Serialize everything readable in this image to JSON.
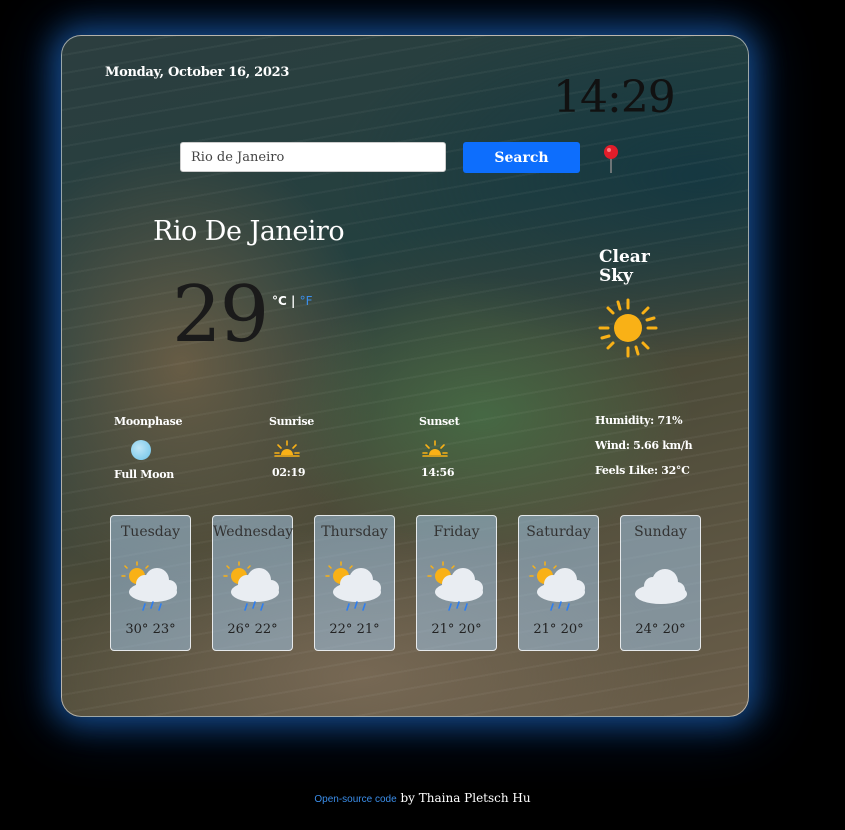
{
  "header": {
    "date": "Monday, October 16, 2023",
    "time": "14:29"
  },
  "search": {
    "value": "Rio de Janeiro",
    "placeholder": "",
    "button_label": "Search",
    "location_icon": "map-pin-icon"
  },
  "current": {
    "city": "Rio De Janeiro",
    "temperature": "29",
    "unit_c": "°C",
    "unit_separator": " | ",
    "unit_f": "°F",
    "description": "Clear Sky",
    "icon": "sun-icon"
  },
  "details": {
    "moonphase_label": "Moonphase",
    "moonphase_value": "Full Moon",
    "sunrise_label": "Sunrise",
    "sunrise_value": "02:19",
    "sunset_label": "Sunset",
    "sunset_value": "14:56",
    "humidity": "Humidity: 71%",
    "wind": "Wind: 5.66 km/h",
    "feels_like": "Feels Like: 32°C"
  },
  "forecast": [
    {
      "day": "Tuesday",
      "temps": "30° 23°",
      "icon": "sun-cloud-rain-icon"
    },
    {
      "day": "Wednesday",
      "temps": "26° 22°",
      "icon": "sun-cloud-rain-icon"
    },
    {
      "day": "Thursday",
      "temps": "22° 21°",
      "icon": "sun-cloud-rain-icon"
    },
    {
      "day": "Friday",
      "temps": "21° 20°",
      "icon": "sun-cloud-rain-icon"
    },
    {
      "day": "Saturday",
      "temps": "21° 20°",
      "icon": "sun-cloud-rain-icon"
    },
    {
      "day": "Sunday",
      "temps": "24° 20°",
      "icon": "cloud-icon"
    }
  ],
  "footer": {
    "link_text": "Open-source code",
    "by_text": " by Thaina Pletsch Hu"
  },
  "colors": {
    "accent": "#0d6efd",
    "glow": "#288cff",
    "sun": "#f9b116"
  }
}
